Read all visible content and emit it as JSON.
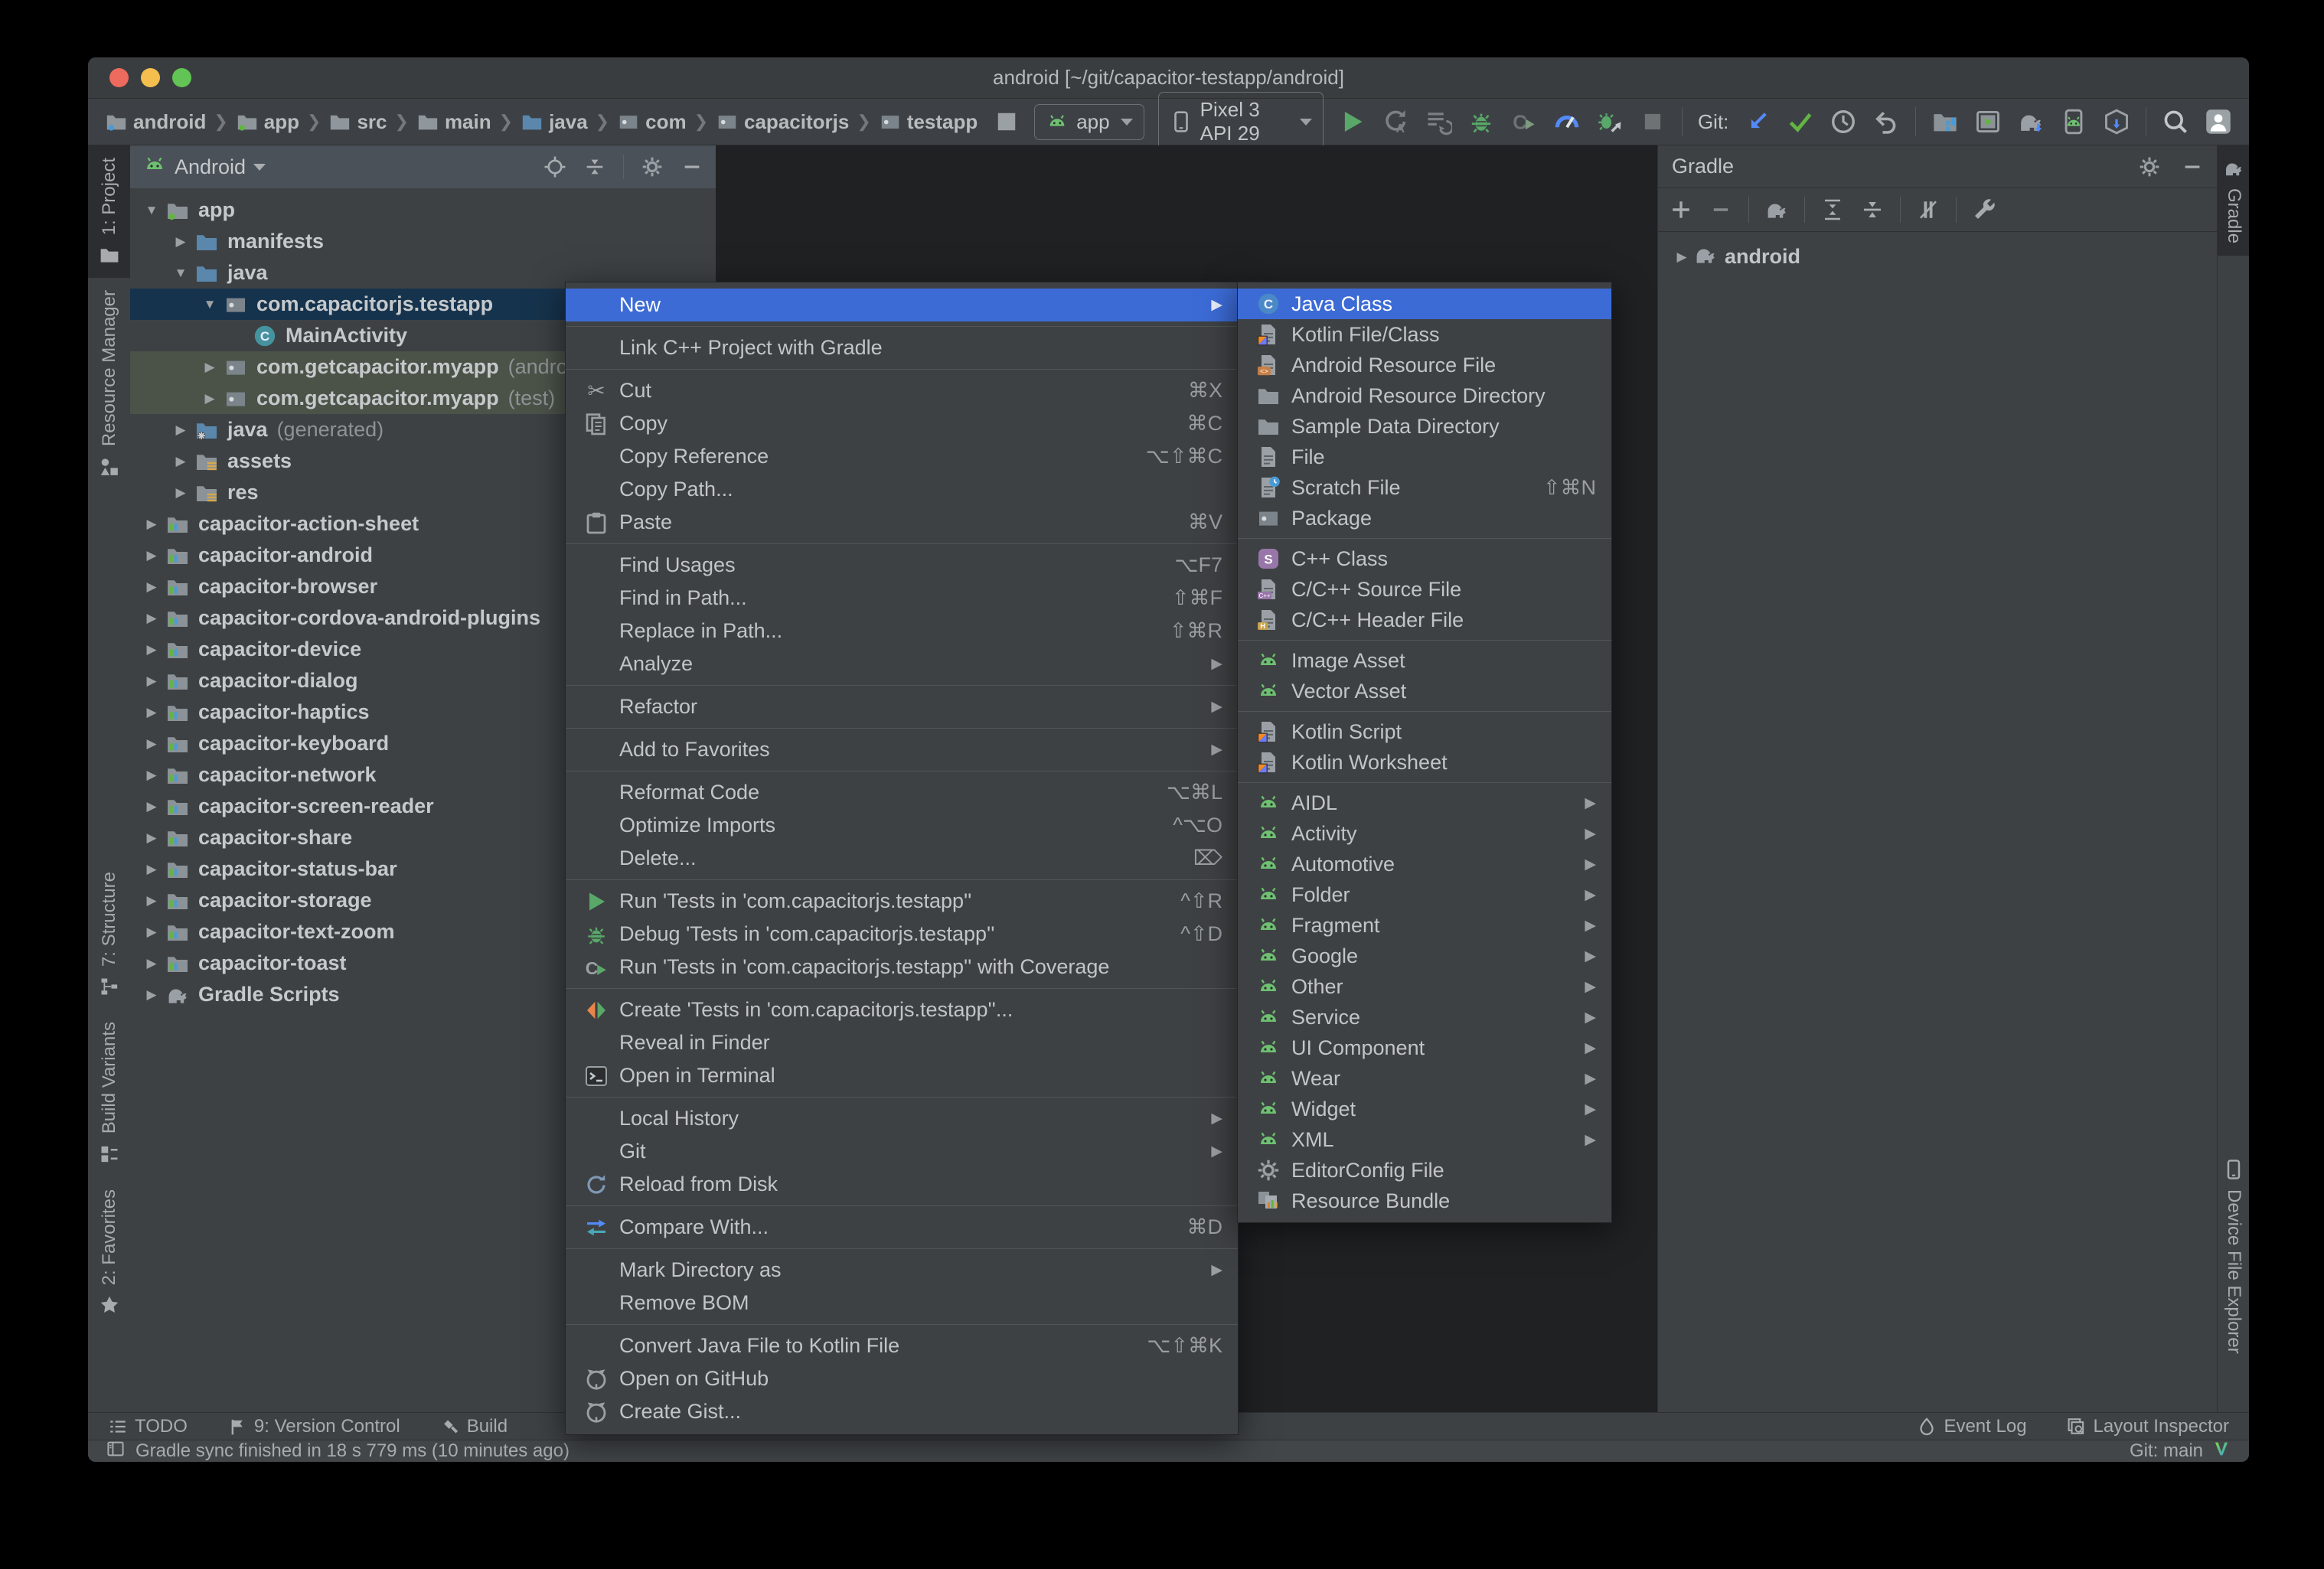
{
  "window": {
    "title": "android [~/git/capacitor-testapp/android]"
  },
  "colors": {
    "accent_selection_blue": "#3c6bd6",
    "tree_selection_navy": "#16334d",
    "test_scope_green_row": "#4b5349",
    "android_green": "#6ec071",
    "run_green": "#59a869",
    "git_update_blue": "#548af7",
    "panel_bg": "#3d4144",
    "editor_bg": "#1f2123"
  },
  "toolbar": {
    "breadcrumbs": [
      {
        "label": "android",
        "icon": "folder-project-icon"
      },
      {
        "label": "app",
        "icon": "module-app-icon"
      },
      {
        "label": "src",
        "icon": "folder-icon"
      },
      {
        "label": "main",
        "icon": "folder-icon"
      },
      {
        "label": "java",
        "icon": "folder-blue-icon"
      },
      {
        "label": "com",
        "icon": "package-icon"
      },
      {
        "label": "capacitorjs",
        "icon": "package-icon"
      },
      {
        "label": "testapp",
        "icon": "package-icon"
      }
    ],
    "lightning_icon": "lightning-icon",
    "app_selector": "app",
    "device_selector": "Pixel 3 API 29",
    "run_icons": [
      "run",
      "apply-changes",
      "apply-code-changes",
      "debug",
      "profile-app",
      "profiler",
      "attach-debugger",
      "stop"
    ],
    "git_label": "Git:",
    "git_icons": [
      "git-update",
      "git-commit",
      "git-history",
      "git-rollback"
    ],
    "tool_icons": [
      "device-manager",
      "running-devices",
      "gradle-sync",
      "avd-manager",
      "sdk-manager"
    ],
    "end_icons": [
      "search",
      "avatar"
    ]
  },
  "left_stripe": [
    {
      "label": "1: Project",
      "icon": "project",
      "active": true
    },
    {
      "label": "Resource Manager",
      "icon": "resource-manager",
      "active": false
    },
    {
      "label": "7: Structure",
      "icon": "structure",
      "active": false,
      "bottom_group": true
    },
    {
      "label": "Build Variants",
      "icon": "build-variants",
      "active": false,
      "bottom_group": true
    },
    {
      "label": "2: Favorites",
      "icon": "favorites",
      "active": false,
      "bottom_group": true
    }
  ],
  "right_stripe": [
    {
      "label": "Gradle",
      "icon": "elephant",
      "active": true
    },
    {
      "label": "Device File Explorer",
      "icon": "phone",
      "active": false,
      "bottom_group": true
    }
  ],
  "project_panel": {
    "mode": "Android",
    "header_icons": [
      "locate",
      "collapse-panel",
      "divider",
      "gear",
      "minimize"
    ],
    "tree": [
      {
        "indent": 0,
        "arrow": "down",
        "icon": "app-folder",
        "label": "app"
      },
      {
        "indent": 1,
        "arrow": "right",
        "icon": "folder-blue",
        "label": "manifests"
      },
      {
        "indent": 1,
        "arrow": "down",
        "icon": "folder-blue",
        "label": "java"
      },
      {
        "indent": 2,
        "arrow": "down",
        "icon": "package",
        "label": "com.capacitorjs.testapp",
        "selected": true
      },
      {
        "indent": 3,
        "arrow": "none",
        "icon": "class",
        "label": "MainActivity"
      },
      {
        "indent": 2,
        "arrow": "right",
        "icon": "package",
        "label": "com.getcapacitor.myapp",
        "suffix": "(andro",
        "green": true
      },
      {
        "indent": 2,
        "arrow": "right",
        "icon": "package",
        "label": "com.getcapacitor.myapp",
        "suffix": "(test)",
        "green": true
      },
      {
        "indent": 1,
        "arrow": "right",
        "icon": "folder-gen",
        "label": "java",
        "suffix": "(generated)",
        "dim": true
      },
      {
        "indent": 1,
        "arrow": "right",
        "icon": "folder-assets",
        "label": "assets"
      },
      {
        "indent": 1,
        "arrow": "right",
        "icon": "folder-assets",
        "label": "res"
      },
      {
        "indent": 0,
        "arrow": "right",
        "icon": "module",
        "label": "capacitor-action-sheet"
      },
      {
        "indent": 0,
        "arrow": "right",
        "icon": "module",
        "label": "capacitor-android"
      },
      {
        "indent": 0,
        "arrow": "right",
        "icon": "module",
        "label": "capacitor-browser"
      },
      {
        "indent": 0,
        "arrow": "right",
        "icon": "module",
        "label": "capacitor-cordova-android-plugins"
      },
      {
        "indent": 0,
        "arrow": "right",
        "icon": "module",
        "label": "capacitor-device"
      },
      {
        "indent": 0,
        "arrow": "right",
        "icon": "module",
        "label": "capacitor-dialog"
      },
      {
        "indent": 0,
        "arrow": "right",
        "icon": "module",
        "label": "capacitor-haptics"
      },
      {
        "indent": 0,
        "arrow": "right",
        "icon": "module",
        "label": "capacitor-keyboard"
      },
      {
        "indent": 0,
        "arrow": "right",
        "icon": "module",
        "label": "capacitor-network"
      },
      {
        "indent": 0,
        "arrow": "right",
        "icon": "module",
        "label": "capacitor-screen-reader"
      },
      {
        "indent": 0,
        "arrow": "right",
        "icon": "module",
        "label": "capacitor-share"
      },
      {
        "indent": 0,
        "arrow": "right",
        "icon": "module",
        "label": "capacitor-status-bar"
      },
      {
        "indent": 0,
        "arrow": "right",
        "icon": "module",
        "label": "capacitor-storage"
      },
      {
        "indent": 0,
        "arrow": "right",
        "icon": "module",
        "label": "capacitor-text-zoom"
      },
      {
        "indent": 0,
        "arrow": "right",
        "icon": "module",
        "label": "capacitor-toast"
      },
      {
        "indent": 0,
        "arrow": "right",
        "icon": "elephant",
        "label": "Gradle Scripts"
      }
    ]
  },
  "gradle_panel": {
    "title": "Gradle",
    "header_icons": [
      "gear",
      "minimize"
    ],
    "tool_groups": [
      [
        "add",
        "remove"
      ],
      [
        "elephant"
      ],
      [
        "expand-all",
        "collapse-panel"
      ],
      [
        "toggle-offline"
      ],
      [
        "wrench"
      ]
    ],
    "tree_item": "android"
  },
  "context_menu": {
    "groups": [
      [
        {
          "label": "New",
          "arrow": true,
          "selected": true
        }
      ],
      [
        {
          "label": "Link C++ Project with Gradle"
        }
      ],
      [
        {
          "label": "Cut",
          "icon": "scissors",
          "shortcut": "⌘X"
        },
        {
          "label": "Copy",
          "icon": "copy",
          "shortcut": "⌘C"
        },
        {
          "label": "Copy Reference",
          "shortcut": "⌥⇧⌘C"
        },
        {
          "label": "Copy Path..."
        },
        {
          "label": "Paste",
          "icon": "paste",
          "shortcut": "⌘V"
        }
      ],
      [
        {
          "label": "Find Usages",
          "shortcut": "⌥F7"
        },
        {
          "label": "Find in Path...",
          "shortcut": "⇧⌘F"
        },
        {
          "label": "Replace in Path...",
          "shortcut": "⇧⌘R"
        },
        {
          "label": "Analyze",
          "arrow": true
        }
      ],
      [
        {
          "label": "Refactor",
          "arrow": true
        }
      ],
      [
        {
          "label": "Add to Favorites",
          "arrow": true
        }
      ],
      [
        {
          "label": "Reformat Code",
          "shortcut": "⌥⌘L"
        },
        {
          "label": "Optimize Imports",
          "shortcut": "^⌥O"
        },
        {
          "label": "Delete...",
          "shortcut": "⌦"
        }
      ],
      [
        {
          "label": "Run 'Tests in 'com.capacitorjs.testapp''",
          "icon": "run",
          "shortcut": "^⇧R"
        },
        {
          "label": "Debug 'Tests in 'com.capacitorjs.testapp''",
          "icon": "debug",
          "shortcut": "^⇧D"
        },
        {
          "label": "Run 'Tests in 'com.capacitorjs.testapp'' with Coverage",
          "icon": "coverage"
        }
      ],
      [
        {
          "label": "Create 'Tests in 'com.capacitorjs.testapp''...",
          "icon": "create-test"
        },
        {
          "label": "Reveal in Finder"
        },
        {
          "label": "Open in Terminal",
          "icon": "terminal"
        }
      ],
      [
        {
          "label": "Local History",
          "arrow": true
        },
        {
          "label": "Git",
          "arrow": true
        },
        {
          "label": "Reload from Disk",
          "icon": "refresh"
        }
      ],
      [
        {
          "label": "Compare With...",
          "icon": "compare",
          "shortcut": "⌘D"
        }
      ],
      [
        {
          "label": "Mark Directory as",
          "arrow": true
        },
        {
          "label": "Remove BOM"
        }
      ],
      [
        {
          "label": "Convert Java File to Kotlin File",
          "shortcut": "⌥⇧⌘K"
        },
        {
          "label": "Open on GitHub",
          "icon": "github"
        },
        {
          "label": "Create Gist...",
          "icon": "github"
        }
      ]
    ]
  },
  "new_submenu": {
    "groups": [
      [
        {
          "label": "Java Class",
          "icon": "java-class",
          "selected": true
        },
        {
          "label": "Kotlin File/Class",
          "icon": "kotlin-file"
        },
        {
          "label": "Android Resource File",
          "icon": "res-file"
        },
        {
          "label": "Android Resource Directory",
          "icon": "folder"
        },
        {
          "label": "Sample Data Directory",
          "icon": "folder"
        },
        {
          "label": "File",
          "icon": "file"
        },
        {
          "label": "Scratch File",
          "icon": "scratch-file",
          "shortcut": "⇧⌘N"
        },
        {
          "label": "Package",
          "icon": "package"
        }
      ],
      [
        {
          "label": "C++ Class",
          "icon": "cpp-class"
        },
        {
          "label": "C/C++ Source File",
          "icon": "cpp-source"
        },
        {
          "label": "C/C++ Header File",
          "icon": "cpp-header"
        }
      ],
      [
        {
          "label": "Image Asset",
          "icon": "android"
        },
        {
          "label": "Vector Asset",
          "icon": "android"
        }
      ],
      [
        {
          "label": "Kotlin Script",
          "icon": "kotlin-file"
        },
        {
          "label": "Kotlin Worksheet",
          "icon": "kotlin-file"
        }
      ],
      [
        {
          "label": "AIDL",
          "icon": "android",
          "arrow": true
        },
        {
          "label": "Activity",
          "icon": "android",
          "arrow": true
        },
        {
          "label": "Automotive",
          "icon": "android",
          "arrow": true
        },
        {
          "label": "Folder",
          "icon": "android",
          "arrow": true
        },
        {
          "label": "Fragment",
          "icon": "android",
          "arrow": true
        },
        {
          "label": "Google",
          "icon": "android",
          "arrow": true
        },
        {
          "label": "Other",
          "icon": "android",
          "arrow": true
        },
        {
          "label": "Service",
          "icon": "android",
          "arrow": true
        },
        {
          "label": "UI Component",
          "icon": "android",
          "arrow": true
        },
        {
          "label": "Wear",
          "icon": "android",
          "arrow": true
        },
        {
          "label": "Widget",
          "icon": "android",
          "arrow": true
        },
        {
          "label": "XML",
          "icon": "android",
          "arrow": true
        },
        {
          "label": "EditorConfig File",
          "icon": "gear"
        },
        {
          "label": "Resource Bundle",
          "icon": "bundle"
        }
      ]
    ]
  },
  "bottom_bar": {
    "left": [
      {
        "label": "TODO",
        "icon": "todo"
      },
      {
        "label": "9: Version Control",
        "icon": "flag"
      },
      {
        "label": "Build",
        "icon": "hammer"
      }
    ],
    "right": [
      {
        "label": "Event Log",
        "icon": "droplet"
      },
      {
        "label": "Layout Inspector",
        "icon": "layout-inspector"
      }
    ]
  },
  "status_bar": {
    "message": "Gradle sync finished in 18 s 779 ms (10 minutes ago)",
    "git_branch": "Git: main"
  }
}
